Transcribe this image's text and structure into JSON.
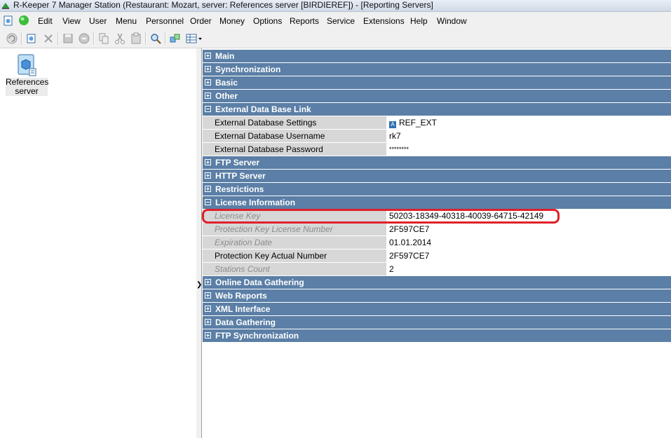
{
  "window": {
    "title": "R-Keeper 7 Manager Station (Restaurant: Mozart, server: References server [BIRDIEREF]) - [Reporting Servers]"
  },
  "menu": {
    "items": [
      "Edit",
      "View",
      "User",
      "Menu",
      "Personnel",
      "Order",
      "Money",
      "Options",
      "Reports",
      "Service",
      "Extensions",
      "Help",
      "Window"
    ]
  },
  "toolbar": {
    "icons": [
      "refresh-icon",
      "new-object-icon",
      "delete-icon",
      "save-icon",
      "cancel-icon",
      "copy-icon",
      "cut-icon",
      "paste-icon",
      "search-icon",
      "link-icon",
      "grid-view-icon"
    ]
  },
  "tree": {
    "item_label": "References server"
  },
  "groups": {
    "main": "Main",
    "synchronization": "Synchronization",
    "basic": "Basic",
    "other": "Other",
    "external_db_link": "External Data Base Link",
    "ftp_server": "FTP Server",
    "http_server": "HTTP Server",
    "restrictions": "Restrictions",
    "license_info": "License Information",
    "online_data_gathering": "Online Data Gathering",
    "web_reports": "Web Reports",
    "xml_interface": "XML Interface",
    "data_gathering": "Data Gathering",
    "ftp_sync": "FTP Synchronization"
  },
  "external_db": {
    "settings_label": "External Database Settings",
    "settings_value": "REF_EXT",
    "username_label": "External Database Username",
    "username_value": "rk7",
    "password_label": "External Database Password",
    "password_value": "********"
  },
  "license": {
    "key_label": "License Key",
    "key_value": "50203-18349-40318-40039-64715-42149",
    "protection_license_label": "Protection Key License Number",
    "protection_license_value": "2F597CE7",
    "expiration_label": "Expiration Date",
    "expiration_value": "01.01.2014",
    "protection_actual_label": "Protection Key Actual Number",
    "protection_actual_value": "2F597CE7",
    "stations_label": "Stations Count",
    "stations_value": "2"
  },
  "colors": {
    "group_header": "#5b7fa6",
    "property_name_bg": "#d7d7d7",
    "highlight": "#e0202a"
  }
}
